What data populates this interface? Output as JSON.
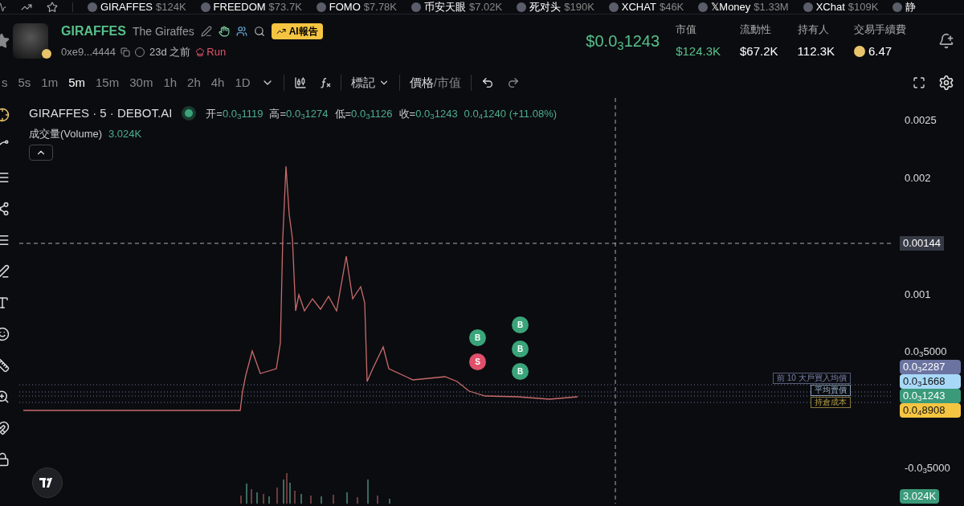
{
  "ticker": [
    {
      "name": "GIRAFFES",
      "value": "$124K"
    },
    {
      "name": "FREEDOM",
      "value": "$73.7K"
    },
    {
      "name": "FOMO",
      "value": "$7.78K"
    },
    {
      "name": "币安天眼",
      "value": "$7.02K"
    },
    {
      "name": "死对头",
      "value": "$190K"
    },
    {
      "name": "XCHAT",
      "value": "$46K"
    },
    {
      "name": "𝕏Money",
      "value": "$1.33M"
    },
    {
      "name": "XChat",
      "value": "$109K"
    },
    {
      "name": "静"
    }
  ],
  "token": {
    "symbol": "GIRAFFES",
    "name": "The Giraffes",
    "ai_report": "AI報告",
    "address": "0xe9...4444",
    "age": "23d 之前",
    "platform": "Run",
    "price": "$0.0$_{3}$1243"
  },
  "stats": [
    {
      "label": "市值",
      "value": "$124.3K",
      "kind": "up"
    },
    {
      "label": "流動性",
      "value": "$67.2K",
      "kind": "plain"
    },
    {
      "label": "持有人",
      "value": "112.3K",
      "kind": "plain"
    },
    {
      "label": "交易手續費",
      "value": "6.47",
      "kind": "coin"
    }
  ],
  "timeframes": [
    {
      "label": "s",
      "selected": false
    },
    {
      "label": "5s",
      "selected": false
    },
    {
      "label": "1m",
      "selected": false
    },
    {
      "label": "5m",
      "selected": true
    },
    {
      "label": "15m",
      "selected": false
    },
    {
      "label": "30m",
      "selected": false
    },
    {
      "label": "1h",
      "selected": false
    },
    {
      "label": "2h",
      "selected": false
    },
    {
      "label": "4h",
      "selected": false
    },
    {
      "label": "1D",
      "selected": false
    }
  ],
  "toolbar": {
    "marks": "標記",
    "separator": "/",
    "price_toggle": [
      {
        "label": "價格",
        "selected": true
      },
      {
        "label": "市值",
        "selected": false
      }
    ]
  },
  "legend": {
    "title": "GIRAFFES · 5 · DEBOT.AI",
    "ohlc": [
      {
        "label": "开=",
        "value": "0.0$_{3}$1119"
      },
      {
        "label": "高=",
        "value": "0.0$_{3}$1274"
      },
      {
        "label": "低=",
        "value": "0.0$_{3}$1126"
      },
      {
        "label": "收=",
        "value": "0.0$_{3}$1243"
      }
    ],
    "change": "0.0$_{4}$1240 (+11.08%)"
  },
  "volume": {
    "label": "成交量(Volume)",
    "value": "3.024K"
  },
  "axis": {
    "ticks": [
      "0.0025",
      "0.002",
      "0.001",
      "0.0$_{3}$5000",
      "-0.0$_{3}$5000"
    ],
    "crosshair": "0.00144",
    "tags": [
      {
        "text": "0.0$_{3}$2287",
        "color": "#6b74a0"
      },
      {
        "text": "0.0$_{3}$1668",
        "color": "#a8d8f8"
      },
      {
        "text": "0.0$_{3}$1243",
        "color": "#3a9a7a"
      },
      {
        "text": "0.0$_{4}$8908",
        "color": "#f5c542"
      }
    ],
    "volume_tag": "3.024K"
  },
  "level_labels": [
    "前 10 大戶買入均價",
    "平均賣價",
    "持倉成本"
  ],
  "trades": [
    {
      "side": "B",
      "kind": "buy"
    },
    {
      "side": "S",
      "kind": "sell"
    },
    {
      "side": "B",
      "kind": "buy"
    },
    {
      "side": "B",
      "kind": "buy"
    },
    {
      "side": "B",
      "kind": "buy"
    }
  ]
}
